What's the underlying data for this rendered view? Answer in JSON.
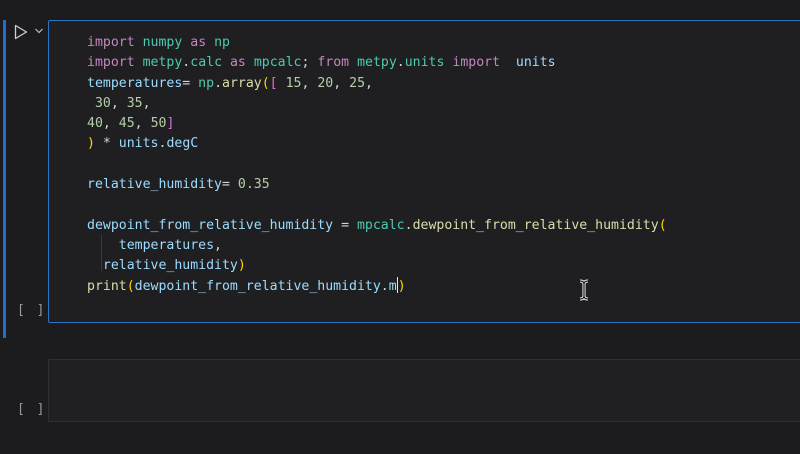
{
  "cells": [
    {
      "execution_label": "[ ]",
      "code_lines": [
        [
          {
            "t": "import",
            "c": "kw"
          },
          {
            "t": " ",
            "c": "op"
          },
          {
            "t": "numpy",
            "c": "mod"
          },
          {
            "t": " ",
            "c": "op"
          },
          {
            "t": "as",
            "c": "kw"
          },
          {
            "t": " ",
            "c": "op"
          },
          {
            "t": "np",
            "c": "mod"
          }
        ],
        [
          {
            "t": "import",
            "c": "kw"
          },
          {
            "t": " ",
            "c": "op"
          },
          {
            "t": "metpy",
            "c": "mod"
          },
          {
            "t": ".",
            "c": "op"
          },
          {
            "t": "calc",
            "c": "mod"
          },
          {
            "t": " ",
            "c": "op"
          },
          {
            "t": "as",
            "c": "kw"
          },
          {
            "t": " ",
            "c": "op"
          },
          {
            "t": "mpcalc",
            "c": "mod"
          },
          {
            "t": "; ",
            "c": "op"
          },
          {
            "t": "from",
            "c": "kw"
          },
          {
            "t": " ",
            "c": "op"
          },
          {
            "t": "metpy",
            "c": "mod"
          },
          {
            "t": ".",
            "c": "op"
          },
          {
            "t": "units",
            "c": "mod"
          },
          {
            "t": " ",
            "c": "op"
          },
          {
            "t": "import",
            "c": "kw"
          },
          {
            "t": "  ",
            "c": "op"
          },
          {
            "t": "units",
            "c": "id"
          }
        ],
        [
          {
            "t": "temperatures",
            "c": "id"
          },
          {
            "t": "= ",
            "c": "op"
          },
          {
            "t": "np",
            "c": "mod"
          },
          {
            "t": ".",
            "c": "op"
          },
          {
            "t": "array",
            "c": "fn"
          },
          {
            "t": "(",
            "c": "br1"
          },
          {
            "t": "[",
            "c": "br2"
          },
          {
            "t": " ",
            "c": "op"
          },
          {
            "t": "15",
            "c": "num"
          },
          {
            "t": ", ",
            "c": "op"
          },
          {
            "t": "20",
            "c": "num"
          },
          {
            "t": ", ",
            "c": "op"
          },
          {
            "t": "25",
            "c": "num"
          },
          {
            "t": ",",
            "c": "op"
          }
        ],
        [
          {
            "t": " ",
            "c": "op"
          },
          {
            "t": "30",
            "c": "num"
          },
          {
            "t": ", ",
            "c": "op"
          },
          {
            "t": "35",
            "c": "num"
          },
          {
            "t": ",",
            "c": "op"
          }
        ],
        [
          {
            "t": "40",
            "c": "num"
          },
          {
            "t": ", ",
            "c": "op"
          },
          {
            "t": "45",
            "c": "num"
          },
          {
            "t": ", ",
            "c": "op"
          },
          {
            "t": "50",
            "c": "num"
          },
          {
            "t": "]",
            "c": "br2"
          }
        ],
        [
          {
            "t": ")",
            "c": "br1"
          },
          {
            "t": " * ",
            "c": "op"
          },
          {
            "t": "units",
            "c": "id"
          },
          {
            "t": ".",
            "c": "op"
          },
          {
            "t": "degC",
            "c": "id"
          }
        ],
        [],
        [
          {
            "t": "relative_humidity",
            "c": "id"
          },
          {
            "t": "= ",
            "c": "op"
          },
          {
            "t": "0.35",
            "c": "num"
          }
        ],
        [],
        [
          {
            "t": "dewpoint_from_relative_humidity",
            "c": "id"
          },
          {
            "t": " = ",
            "c": "op"
          },
          {
            "t": "mpcalc",
            "c": "mod"
          },
          {
            "t": ".",
            "c": "op"
          },
          {
            "t": "dewpoint_from_relative_humidity",
            "c": "fn"
          },
          {
            "t": "(",
            "c": "br1"
          }
        ],
        [
          {
            "t": "    ",
            "c": "op"
          },
          {
            "t": "temperatures",
            "c": "id"
          },
          {
            "t": ",",
            "c": "op"
          }
        ],
        [
          {
            "t": "  ",
            "c": "op"
          },
          {
            "t": "relative_humidity",
            "c": "id"
          },
          {
            "t": ")",
            "c": "br1"
          }
        ],
        [
          {
            "t": "print",
            "c": "fn"
          },
          {
            "t": "(",
            "c": "br1"
          },
          {
            "t": "dewpoint_from_relative_humidity",
            "c": "id"
          },
          {
            "t": ".",
            "c": "op"
          },
          {
            "t": "m",
            "c": "id"
          },
          {
            "t": "CARET",
            "c": "caret"
          },
          {
            "t": ")",
            "c": "br1"
          }
        ]
      ]
    },
    {
      "execution_label": "[ ]",
      "code_lines": []
    }
  ],
  "icons": {
    "run": "play-icon",
    "expand": "chevron-down-icon",
    "mouse": "text-cursor-icon"
  },
  "colors": {
    "focus_accent": "#1f6fce",
    "keyword": "#c586c0",
    "variable": "#9cdcfe",
    "module": "#4ec9b0",
    "function": "#dcdcaa",
    "number": "#b5cea8"
  }
}
